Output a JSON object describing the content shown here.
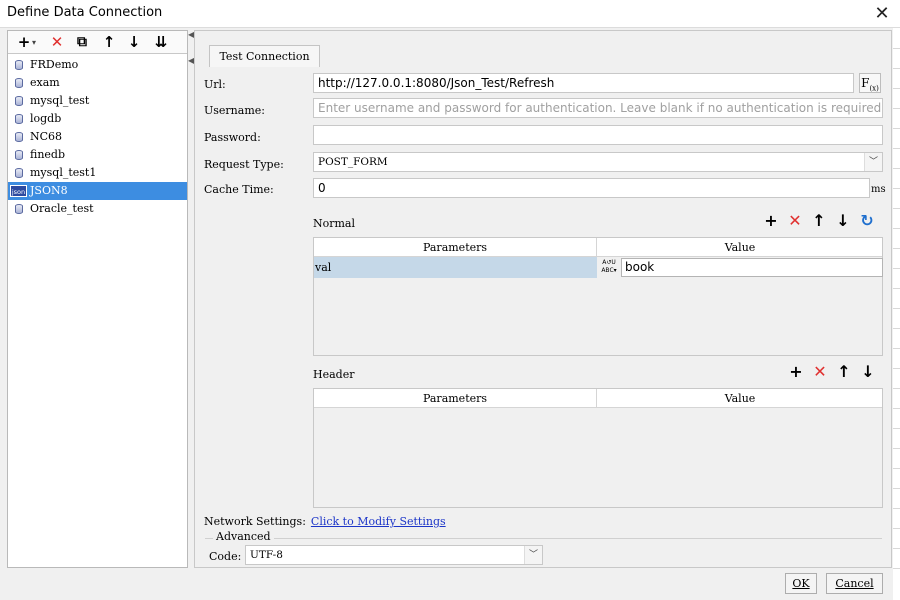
{
  "window": {
    "title": "Define Data Connection",
    "close_glyph": "✕"
  },
  "toolbar": {
    "add": "+",
    "add_caret": "▾",
    "delete": "✕",
    "copy": "⧉",
    "move_up": "↑",
    "move_down": "↓",
    "sort": "⇊"
  },
  "tree": {
    "items": [
      {
        "label": "FRDemo",
        "selected": false
      },
      {
        "label": "exam",
        "selected": false
      },
      {
        "label": "mysql_test",
        "selected": false
      },
      {
        "label": "logdb",
        "selected": false
      },
      {
        "label": "NC68",
        "selected": false
      },
      {
        "label": "finedb",
        "selected": false
      },
      {
        "label": "mysql_test1",
        "selected": false
      },
      {
        "label": "JSON8",
        "selected": true,
        "icon_text": "json"
      },
      {
        "label": "Oracle_test",
        "selected": false
      }
    ]
  },
  "form": {
    "test_connection": "Test Connection",
    "url_label": "Url:",
    "url_value": "http://127.0.0.1:8080/Json_Test/Refresh",
    "fx_label": "F",
    "fx_sub": "(x)",
    "username_label": "Username:",
    "username_placeholder": "Enter username and password for authentication. Leave blank if no authentication is required. Only Auth",
    "password_label": "Password:",
    "request_type_label": "Request Type:",
    "request_type_value": "POST_FORM",
    "cache_time_label": "Cache Time:",
    "cache_time_value": "0",
    "cache_time_unit": "ms"
  },
  "normal": {
    "label": "Normal",
    "columns": [
      "Parameters",
      "Value"
    ],
    "rows": [
      {
        "param": "val",
        "type_badge_top": "A↺U",
        "type_badge_bottom": "ABC▾",
        "value": "book"
      }
    ],
    "icons": {
      "add": "+",
      "delete": "✕",
      "up": "↑",
      "down": "↓",
      "refresh": "↻"
    }
  },
  "header": {
    "label": "Header",
    "columns": [
      "Parameters",
      "Value"
    ],
    "icons": {
      "add": "+",
      "delete": "✕",
      "up": "↑",
      "down": "↓"
    }
  },
  "network": {
    "label": "Network Settings:",
    "link": "Click to Modify Settings"
  },
  "advanced": {
    "label": "Advanced",
    "code_label": "Code:",
    "code_value": "UTF-8"
  },
  "buttons": {
    "ok": "OK",
    "cancel": "Cancel"
  },
  "colors": {
    "selection": "#3d8de1",
    "row_highlight": "#c5d8e8",
    "delete_red": "#e0302f",
    "link_blue": "#1c35c8"
  }
}
